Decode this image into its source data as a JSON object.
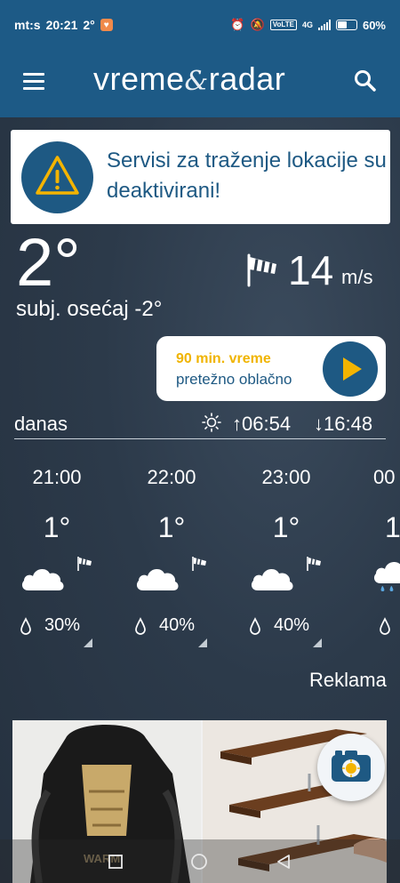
{
  "status_bar": {
    "carrier": "mt:s",
    "time": "20:21",
    "temp": "2°",
    "network": "4G",
    "volte": "VoLTE",
    "battery": "60%"
  },
  "app": {
    "logo_left": "vreme",
    "logo_amp": "&",
    "logo_right": "radar"
  },
  "alert": {
    "text": "Servisi za traženje lokacije su deaktivirani!"
  },
  "current": {
    "temperature": "2°",
    "feels_like": "subj. osećaj -2°",
    "wind_value": "14",
    "wind_unit": "m/s"
  },
  "nowcast": {
    "title": "90 min. vreme",
    "description": "pretežno oblačno"
  },
  "day": {
    "label": "danas",
    "sunrise": "↑06:54",
    "sunset": "↓16:48"
  },
  "hours": [
    {
      "time": "21:00",
      "temp": "1°",
      "precip": "30%"
    },
    {
      "time": "22:00",
      "temp": "1°",
      "precip": "40%"
    },
    {
      "time": "23:00",
      "temp": "1°",
      "precip": "40%"
    },
    {
      "time": "00",
      "temp": "1",
      "precip": ""
    }
  ],
  "ad": {
    "label": "Reklama",
    "brand_text": "WARM"
  },
  "colors": {
    "brand": "#1d5a86",
    "accent_yellow": "#f0b400",
    "background": "#2f3d4d"
  }
}
